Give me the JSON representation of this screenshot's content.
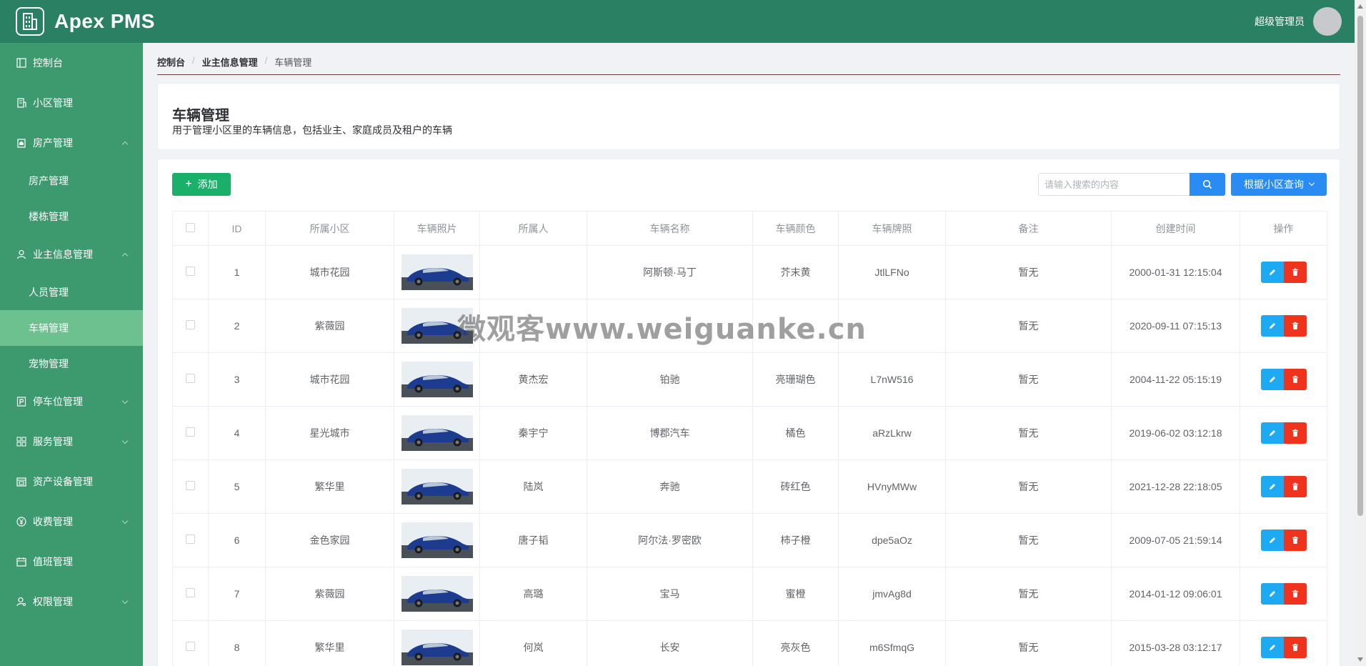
{
  "app": {
    "title": "Apex PMS",
    "user": "超级管理员"
  },
  "colors": {
    "header": "#2a8062",
    "sidebar": "#3d9a6f",
    "active": "#6cc18f",
    "primary": "#2a8bf2",
    "success": "#1bb06a",
    "danger": "#f0331c",
    "info": "#1ea9f3"
  },
  "sidebar": {
    "items": [
      {
        "label": "控制台",
        "icon": "dashboard-icon"
      },
      {
        "label": "小区管理",
        "icon": "building-icon"
      },
      {
        "label": "房产管理",
        "icon": "house-icon",
        "expanded": true,
        "children": [
          "房产管理",
          "楼栋管理"
        ]
      },
      {
        "label": "业主信息管理",
        "icon": "user-icon",
        "expanded": true,
        "children": [
          "人员管理",
          "车辆管理",
          "宠物管理"
        ]
      },
      {
        "label": "停车位管理",
        "icon": "parking-icon"
      },
      {
        "label": "服务管理",
        "icon": "grid-icon"
      },
      {
        "label": "资产设备管理",
        "icon": "asset-icon"
      },
      {
        "label": "收费管理",
        "icon": "yen-icon"
      },
      {
        "label": "值班管理",
        "icon": "calendar-icon"
      },
      {
        "label": "权限管理",
        "icon": "permission-icon"
      }
    ],
    "active": "车辆管理"
  },
  "breadcrumb": [
    "控制台",
    "业主信息管理",
    "车辆管理"
  ],
  "page": {
    "title": "车辆管理",
    "description": "用于管理小区里的车辆信息，包括业主、家庭成员及租户的车辆"
  },
  "toolbar": {
    "add_label": "添加",
    "search_placeholder": "请输入搜索的内容",
    "query_label": "根据小区查询"
  },
  "table": {
    "headers": [
      "ID",
      "所属小区",
      "车辆照片",
      "所属人",
      "车辆名称",
      "车辆颜色",
      "车辆牌照",
      "备注",
      "创建时间",
      "操作"
    ],
    "rows": [
      {
        "id": "1",
        "community": "城市花园",
        "owner": "",
        "name": "阿斯顿·马丁",
        "color": "芥末黄",
        "plate": "JtlLFNo",
        "remark": "暂无",
        "created": "2000-01-31 12:15:04"
      },
      {
        "id": "2",
        "community": "紫薇园",
        "owner": "",
        "name": "",
        "color": "",
        "plate": "",
        "remark": "暂无",
        "created": "2020-09-11 07:15:13"
      },
      {
        "id": "3",
        "community": "城市花园",
        "owner": "黄杰宏",
        "name": "铂驰",
        "color": "亮珊瑚色",
        "plate": "L7nW516",
        "remark": "暂无",
        "created": "2004-11-22 05:15:19"
      },
      {
        "id": "4",
        "community": "星光城市",
        "owner": "秦宇宁",
        "name": "博郡汽车",
        "color": "橘色",
        "plate": "aRzLkrw",
        "remark": "暂无",
        "created": "2019-06-02 03:12:18"
      },
      {
        "id": "5",
        "community": "繁华里",
        "owner": "陆岚",
        "name": "奔驰",
        "color": "砖红色",
        "plate": "HVnyMWw",
        "remark": "暂无",
        "created": "2021-12-28 22:18:05"
      },
      {
        "id": "6",
        "community": "金色家园",
        "owner": "唐子韬",
        "name": "阿尔法·罗密欧",
        "color": "柿子橙",
        "plate": "dpe5aOz",
        "remark": "暂无",
        "created": "2009-07-05 21:59:14"
      },
      {
        "id": "7",
        "community": "紫薇园",
        "owner": "高璐",
        "name": "宝马",
        "color": "蜜橙",
        "plate": "jmvAg8d",
        "remark": "暂无",
        "created": "2014-01-12 09:06:01"
      },
      {
        "id": "8",
        "community": "繁华里",
        "owner": "何岚",
        "name": "长安",
        "color": "亮灰色",
        "plate": "m6SfmqG",
        "remark": "暂无",
        "created": "2015-03-28 03:12:17"
      }
    ]
  },
  "watermark": "微观客www.weiguanke.cn"
}
